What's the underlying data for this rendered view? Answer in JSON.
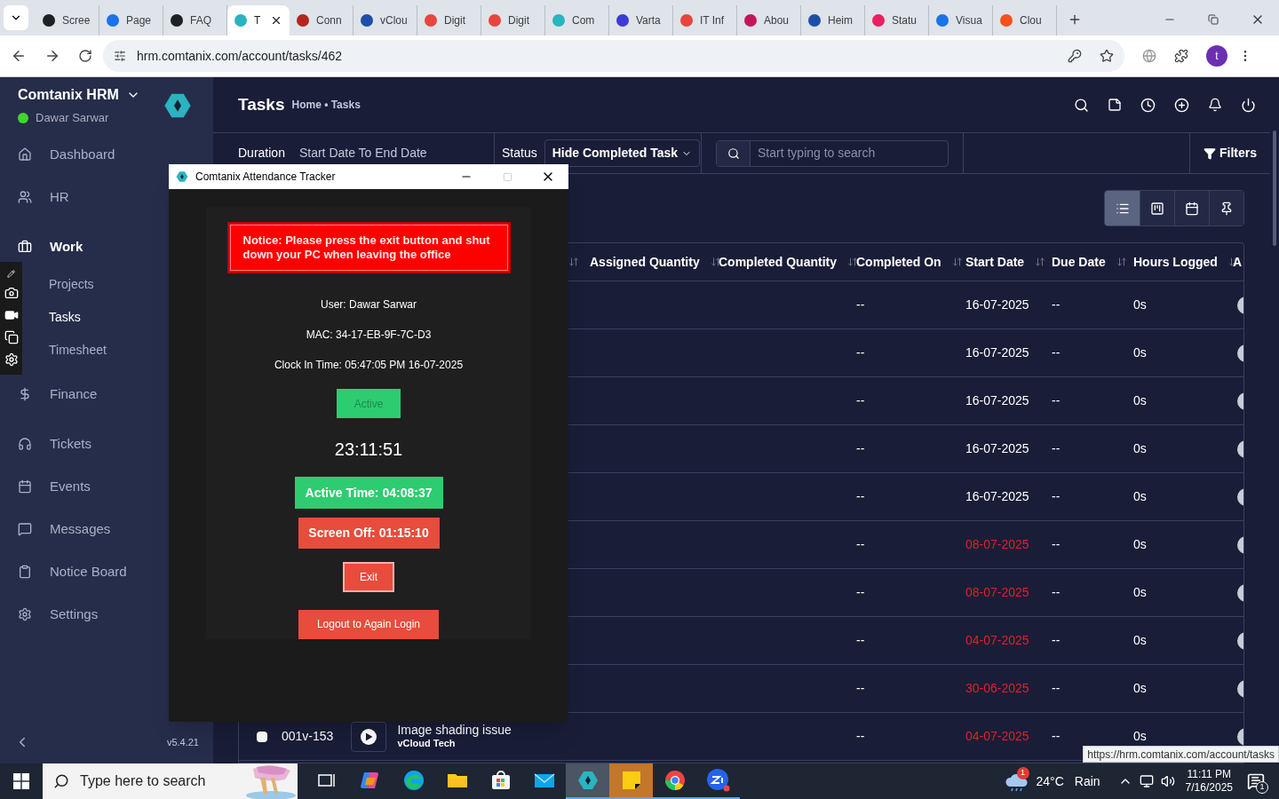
{
  "browser": {
    "tabs": [
      {
        "label": "Scree",
        "selected": false,
        "color": "#202124"
      },
      {
        "label": "Page",
        "selected": false,
        "color": "#1a73e8"
      },
      {
        "label": "FAQ",
        "selected": false,
        "color": "#202124"
      },
      {
        "label": "T",
        "selected": true,
        "color": "#2bb3c0"
      },
      {
        "label": "Conn",
        "selected": false,
        "color": "#b3261e"
      },
      {
        "label": "vClou",
        "selected": false,
        "color": "#1e4fa8"
      },
      {
        "label": "Digit",
        "selected": false,
        "color": "#e8453c"
      },
      {
        "label": "Digit",
        "selected": false,
        "color": "#e8453c"
      },
      {
        "label": "Com",
        "selected": false,
        "color": "#2bb3c0"
      },
      {
        "label": "Varta",
        "selected": false,
        "color": "#3b3bd6"
      },
      {
        "label": "IT Inf",
        "selected": false,
        "color": "#e8453c"
      },
      {
        "label": "Abou",
        "selected": false,
        "color": "#c2185b"
      },
      {
        "label": "Heim",
        "selected": false,
        "color": "#1e4fa8"
      },
      {
        "label": "Statu",
        "selected": false,
        "color": "#e91e63"
      },
      {
        "label": "Visua",
        "selected": false,
        "color": "#1a73e8"
      },
      {
        "label": "Clou",
        "selected": false,
        "color": "#f4511e"
      }
    ],
    "url": "hrm.comtanix.com/account/tasks/462",
    "profile": "t"
  },
  "sidebar": {
    "brand": "Comtanix HRM",
    "user": "Dawar Sarwar",
    "online": true,
    "items": [
      {
        "label": "Dashboard",
        "selected": false
      },
      {
        "label": "HR",
        "selected": false
      },
      {
        "label": "Work",
        "selected": false,
        "expanded": true,
        "children": [
          {
            "label": "Projects",
            "selected": false
          },
          {
            "label": "Tasks",
            "selected": true
          },
          {
            "label": "Timesheet",
            "selected": false
          }
        ]
      },
      {
        "label": "Finance",
        "selected": false
      },
      {
        "label": "Tickets",
        "selected": false
      },
      {
        "label": "Events",
        "selected": false
      },
      {
        "label": "Messages",
        "selected": false
      },
      {
        "label": "Notice Board",
        "selected": false
      },
      {
        "label": "Settings",
        "selected": false
      }
    ],
    "version": "v5.4.21"
  },
  "header": {
    "title": "Tasks",
    "breadcrumb": "Home • Tasks"
  },
  "filters": {
    "duration_label": "Duration",
    "duration_value": "Start Date To End Date",
    "status_label": "Status",
    "status_value": "Hide Completed Task",
    "search_placeholder": "Start typing to search",
    "filters_label": "Filters"
  },
  "view_toggle": [
    {
      "selected": true
    },
    {
      "selected": false
    },
    {
      "selected": false
    },
    {
      "selected": false
    }
  ],
  "table": {
    "columns": [
      "Assigned Quantity",
      "Completed Quantity",
      "Completed On",
      "Start Date",
      "Due Date",
      "Hours Logged",
      "A"
    ],
    "rows": [
      {
        "completed_on": "--",
        "start_date": "16-07-2025",
        "overdue": false,
        "due_date": "--",
        "hours": "0s"
      },
      {
        "completed_on": "--",
        "start_date": "16-07-2025",
        "overdue": false,
        "due_date": "--",
        "hours": "0s"
      },
      {
        "completed_on": "--",
        "start_date": "16-07-2025",
        "overdue": false,
        "due_date": "--",
        "hours": "0s"
      },
      {
        "completed_on": "--",
        "start_date": "16-07-2025",
        "overdue": false,
        "due_date": "--",
        "hours": "0s"
      },
      {
        "completed_on": "--",
        "start_date": "16-07-2025",
        "overdue": false,
        "due_date": "--",
        "hours": "0s"
      },
      {
        "completed_on": "--",
        "start_date": "08-07-2025",
        "overdue": true,
        "due_date": "--",
        "hours": "0s"
      },
      {
        "completed_on": "--",
        "start_date": "08-07-2025",
        "overdue": true,
        "due_date": "--",
        "hours": "0s"
      },
      {
        "completed_on": "--",
        "start_date": "04-07-2025",
        "overdue": true,
        "due_date": "--",
        "hours": "0s"
      },
      {
        "completed_on": "--",
        "start_date": "30-06-2025",
        "overdue": true,
        "due_date": "--",
        "hours": "0s"
      },
      {
        "checked": false,
        "id": "001v-153",
        "task": "Image shading issue",
        "project": "vCloud Tech",
        "completed_on": "--",
        "start_date": "04-07-2025",
        "overdue": true,
        "due_date": "--",
        "hours": "0s"
      }
    ]
  },
  "tracker": {
    "title": "Comtanix Attendance Tracker",
    "notice": "Notice: Please press the exit button and shut down your PC when leaving the office",
    "user": "User: Dawar Sarwar",
    "mac": "MAC: 34-17-EB-9F-7C-D3",
    "clock_in": "Clock In Time: 05:47:05 PM 16-07-2025",
    "status": "Active",
    "timer": "23:11:51",
    "active_time": "Active Time: 04:08:37",
    "screen_off": "Screen Off: 01:15:10",
    "exit": "Exit",
    "logout": "Logout to Again Login"
  },
  "status_link": "https://hrm.comtanix.com/account/tasks",
  "taskbar": {
    "search_placeholder": "Type here to search",
    "apps": [
      {
        "running": false,
        "focused": false,
        "attention": false
      },
      {
        "running": false,
        "focused": false,
        "attention": false
      },
      {
        "running": false,
        "focused": false,
        "attention": false
      },
      {
        "running": false,
        "focused": false,
        "attention": false
      },
      {
        "running": false,
        "focused": false,
        "attention": false
      },
      {
        "running": false,
        "focused": false,
        "attention": false
      },
      {
        "running": true,
        "focused": true,
        "attention": false
      },
      {
        "running": true,
        "focused": false,
        "attention": true
      },
      {
        "running": true,
        "focused": false,
        "attention": false
      },
      {
        "running": true,
        "focused": false,
        "attention": false
      }
    ],
    "weather_badge": "1",
    "temperature": "24°C",
    "condition": "Rain",
    "time": "11:11 PM",
    "date": "7/16/2025",
    "notifications": "1"
  }
}
